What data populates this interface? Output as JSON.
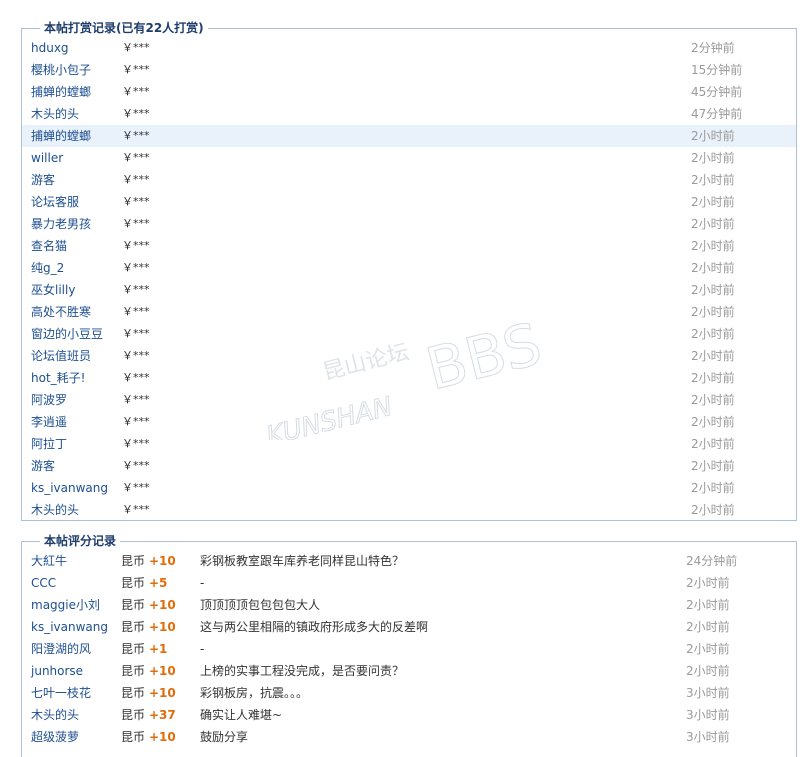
{
  "reward": {
    "title": "本帖打赏记录(已有22人打赏)",
    "rows": [
      {
        "name": "hduxg",
        "amount": "￥***",
        "time": "2分钟前"
      },
      {
        "name": "樱桃小包子",
        "amount": "￥***",
        "time": "15分钟前"
      },
      {
        "name": "捕蝉的螳螂",
        "amount": "￥***",
        "time": "45分钟前"
      },
      {
        "name": "木头的头",
        "amount": "￥***",
        "time": "47分钟前"
      },
      {
        "name": "捕蝉的螳螂",
        "amount": "￥***",
        "time": "2小时前"
      },
      {
        "name": "willer",
        "amount": "￥***",
        "time": "2小时前"
      },
      {
        "name": "游客",
        "amount": "￥***",
        "time": "2小时前"
      },
      {
        "name": "论坛客服",
        "amount": "￥***",
        "time": "2小时前"
      },
      {
        "name": "暴力老男孩",
        "amount": "￥***",
        "time": "2小时前"
      },
      {
        "name": "查名猫",
        "amount": "￥***",
        "time": "2小时前"
      },
      {
        "name": "纯g_2",
        "amount": "￥***",
        "time": "2小时前"
      },
      {
        "name": "巫女lilly",
        "amount": "￥***",
        "time": "2小时前"
      },
      {
        "name": "高处不胜寒",
        "amount": "￥***",
        "time": "2小时前"
      },
      {
        "name": "窗边的小豆豆",
        "amount": "￥***",
        "time": "2小时前"
      },
      {
        "name": "论坛值班员",
        "amount": "￥***",
        "time": "2小时前"
      },
      {
        "name": "hot_耗子!",
        "amount": "￥***",
        "time": "2小时前"
      },
      {
        "name": "阿波罗",
        "amount": "￥***",
        "time": "2小时前"
      },
      {
        "name": "李逍遥",
        "amount": "￥***",
        "time": "2小时前"
      },
      {
        "name": "阿拉丁",
        "amount": "￥***",
        "time": "2小时前"
      },
      {
        "name": "游客",
        "amount": "￥***",
        "time": "2小时前"
      },
      {
        "name": "ks_ivanwang",
        "amount": "￥***",
        "time": "2小时前"
      },
      {
        "name": "木头的头",
        "amount": "￥***",
        "time": "2小时前"
      }
    ]
  },
  "rating": {
    "title": "本帖评分记录",
    "rows": [
      {
        "name": "大紅牛",
        "currency": "昆币",
        "score": "+10",
        "reason": "彩钢板教室跟车库养老同样昆山特色？",
        "time": "24分钟前"
      },
      {
        "name": "CCC",
        "currency": "昆币",
        "score": "+5",
        "reason": "-",
        "time": "2小时前"
      },
      {
        "name": "maggie小刘",
        "currency": "昆币",
        "score": "+10",
        "reason": "顶顶顶顶包包包包大人",
        "time": "2小时前"
      },
      {
        "name": "ks_ivanwang",
        "currency": "昆币",
        "score": "+10",
        "reason": "这与两公里相隔的镇政府形成多大的反差啊",
        "time": "2小时前"
      },
      {
        "name": "阳澄湖的风",
        "currency": "昆币",
        "score": "+1",
        "reason": "-",
        "time": "2小时前"
      },
      {
        "name": "junhorse",
        "currency": "昆币",
        "score": "+10",
        "reason": "上榜的实事工程没完成，是否要问责？",
        "time": "2小时前"
      },
      {
        "name": "七叶一枝花",
        "currency": "昆币",
        "score": "+10",
        "reason": "彩钢板房，抗震。。。",
        "time": "3小时前"
      },
      {
        "name": "木头的头",
        "currency": "昆币",
        "score": "+37",
        "reason": "确实让人难堪~",
        "time": "3小时前"
      },
      {
        "name": "超级菠萝",
        "currency": "昆币",
        "score": "+10",
        "reason": "鼓励分享",
        "time": "3小时前"
      }
    ]
  },
  "watermark": {
    "cn": "昆山论坛",
    "en": "KUNSHAN",
    "bbs": "BBS"
  },
  "colors": {
    "link": "#1e4f91",
    "score": "#e06d0c",
    "border": "#aec0d4",
    "highlight": "#e9f1fa"
  }
}
